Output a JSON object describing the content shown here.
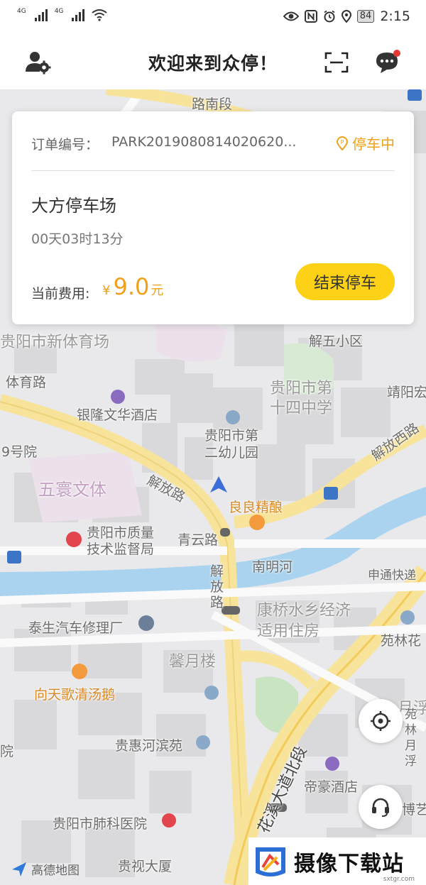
{
  "status_bar": {
    "network_1": "4G",
    "network_2": "4G",
    "battery": "84",
    "time": "2:15"
  },
  "header": {
    "title": "欢迎来到众停！"
  },
  "order": {
    "number_label": "订单编号：",
    "number_value": "PARK2019080814020620...",
    "status": "停车中",
    "lot_name": "大方停车场",
    "duration": "00天03时13分",
    "fee_label": "当前费用:",
    "currency": "¥",
    "fee_amount": "9.0",
    "fee_unit": "元",
    "end_button": "结束停车"
  },
  "map": {
    "labels": [
      "路南段",
      "贵阳市新体育场",
      "解五小区",
      "体育路",
      "贵阳市第十四中学",
      "靖阳宏",
      "银隆文华酒店",
      "贵阳市第二幼儿园",
      "解放西路",
      "9号院",
      "五寰文体",
      "解放路",
      "良良精酿",
      "贵阳市质量技术监督局",
      "青云路",
      "南明河",
      "申通快递",
      "解放路",
      "康桥水乡经济适用住房",
      "泰生汽车修理厂",
      "苑林花",
      "馨月楼",
      "向天歌清汤鹅",
      "月浮",
      "贵惠河滨苑",
      "花溪大道北段",
      "苑林月浮",
      "帝豪酒店",
      "院",
      "贵阳市肺科医院",
      "博艺",
      "贵视大厦"
    ],
    "provider": "高德地图"
  },
  "watermark": {
    "text": "摄像下载站",
    "sub": "sxtgr.com"
  },
  "colors": {
    "accent": "#f0a11b",
    "button": "#fcd116",
    "water": "#a9d3ee",
    "road": "#f8e39a"
  }
}
